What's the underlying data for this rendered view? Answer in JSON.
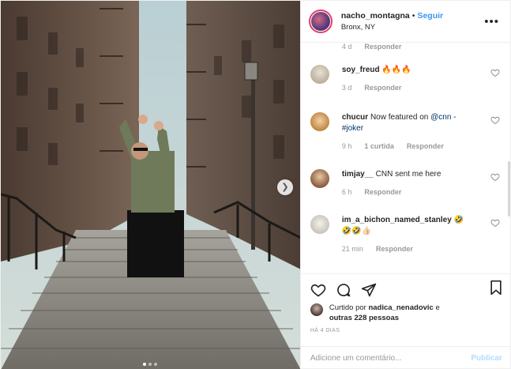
{
  "header": {
    "username": "nacho_montagna",
    "separator": "•",
    "follow_label": "Seguir",
    "location": "Bronx, NY",
    "more_label": "•••"
  },
  "comments": [
    {
      "username": "",
      "text": "",
      "time": "4 d",
      "likes": "",
      "reply_label": "Responder"
    },
    {
      "username": "soy_freud",
      "text": "🔥🔥🔥",
      "time": "3 d",
      "likes": "",
      "reply_label": "Responder"
    },
    {
      "username": "chucur",
      "text_pre": "Now featured on ",
      "mention": "@cnn",
      "text_post": " -",
      "hashtag": "#joker",
      "time": "9 h",
      "likes": "1 curtida",
      "reply_label": "Responder"
    },
    {
      "username": "timjay__",
      "text": "CNN sent me here",
      "time": "6 h",
      "likes": "",
      "reply_label": "Responder"
    },
    {
      "username": "im_a_bichon_named_stanley",
      "text": "🤣",
      "text2": "🤣🤣👍🏻",
      "time": "21 min",
      "likes": "",
      "reply_label": "Responder"
    }
  ],
  "likes": {
    "prefix": "Curtido por ",
    "user": "nadica_nenadovic",
    "middle": " e",
    "line2": "outras 228 pessoas"
  },
  "time_ago": "HÁ 4 DIAS",
  "add_comment": {
    "placeholder": "Adicione um comentário...",
    "publish_label": "Publicar"
  },
  "colors": {
    "accent": "#3897f0",
    "publish_disabled": "#b3dbff",
    "muted": "#999999",
    "story_ring": "#e33e6c"
  }
}
